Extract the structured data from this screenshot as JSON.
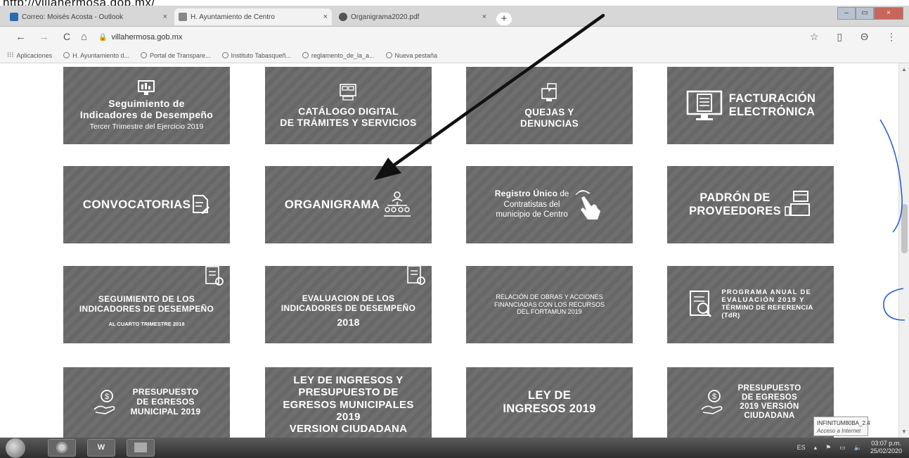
{
  "caption_url": "http://villahermosa.gob.mx/",
  "tabs": [
    {
      "label": "Correo: Moisés Acosta - Outlook",
      "close": "×",
      "active": false
    },
    {
      "label": "H. Ayuntamiento de Centro",
      "close": "×",
      "active": true
    },
    {
      "label": "Organigrama2020.pdf",
      "close": "×",
      "active": false
    }
  ],
  "new_tab": "+",
  "window_controls": {
    "minimize": "–",
    "maximize": "▭",
    "close": "×"
  },
  "nav": {
    "back": "←",
    "forward": "→",
    "reload": "C",
    "home": "⌂"
  },
  "address": {
    "lock": "🔒",
    "url": "villahermosa.gob.mx"
  },
  "toolbar_right": {
    "star": "☆",
    "ext": "▯",
    "profile": "Θ",
    "menu": "⋮"
  },
  "bookmarks": [
    {
      "label": "Aplicaciones",
      "icon": "apps-icon"
    },
    {
      "label": "H. Ayuntamiento d...",
      "icon": "site-icon"
    },
    {
      "label": "Portal de Transpare...",
      "icon": "site-icon"
    },
    {
      "label": "Instituto Tabasqueñ...",
      "icon": "site-icon"
    },
    {
      "label": "reglamento_de_la_a...",
      "icon": "globe-icon"
    },
    {
      "label": "Nueva pestaña",
      "icon": "globe-icon"
    }
  ],
  "tiles": {
    "seguimiento_desempeno": {
      "line1": "Seguimiento de",
      "line2": "Indicadores de Desempeño",
      "line3": "Tercer Trimestre del Ejercicio 2019"
    },
    "catalogo": {
      "line1": "CATÁLOGO DIGITAL",
      "line2": "DE TRÁMITES Y SERVICIOS"
    },
    "quejas": {
      "line1": "QUEJAS Y",
      "line2": "DENUNCIAS"
    },
    "facturacion": {
      "line1": "FACTURACIÓN",
      "line2": "ELECTRÓNICA"
    },
    "convocatorias": {
      "line1": "CONVOCATORIAS"
    },
    "organigrama": {
      "line1": "ORGANIGRAMA"
    },
    "registro": {
      "line1a": "Registro Único",
      "line1b": " de",
      "line2": "Contratistas del",
      "line3": "municipio de Centro"
    },
    "padron": {
      "line1": "PADRÓN DE",
      "line2": "PROVEEDORES"
    },
    "seguimiento_cuarto": {
      "line1": "SEGUIMIENTO DE LOS",
      "line2": "INDICADORES DE DESEMPEÑO",
      "line3": "AL CUARTO TRIMESTRE 2018"
    },
    "evaluacion": {
      "line1": "EVALUACION DE LOS",
      "line2": "INDICADORES DE DESEMPEÑO",
      "line3": "2018"
    },
    "fortamun": {
      "line1": "RELACIÓN DE OBRAS Y ACCIONES",
      "line2": "FINANCIADAS CON LOS RECURSOS",
      "line3": "DEL FORTAMUN 2019"
    },
    "programa_anual": {
      "line1": "PROGRAMA ANUAL DE",
      "line2": "EVALUACIÓN 2019 Y",
      "line3": "TÉRMINO DE REFERENCIA",
      "line4": "(TdR)"
    },
    "presupuesto_egresos": {
      "line1": "PRESUPUESTO",
      "line2": "DE EGRESOS",
      "line3": "MUNICIPAL 2019"
    },
    "ley_ingresos_ciudadana": {
      "line1": "LEY DE INGRESOS Y",
      "line2": "PRESUPUESTO DE",
      "line3": "EGRESOS MUNICIPALES",
      "line4": "2019",
      "line5": "VERSION CIUDADANA"
    },
    "ley_ingresos_2019": {
      "line1": "LEY DE",
      "line2": "INGRESOS 2019"
    },
    "presupuesto_ciudadana": {
      "line1": "PRESUPUESTO",
      "line2": "DE EGRESOS",
      "line3": "2019 VERSIÓN",
      "line4": "CIUDADANA"
    }
  },
  "taskbar": {
    "word_label": "W",
    "language": "ES",
    "time": "03:07 p.m.",
    "date": "25/02/2020"
  },
  "notification": {
    "title": "INFINITUM80BA_2.4",
    "status": "Acceso a Internet"
  },
  "colors": {
    "tile": "#6a6a6a",
    "tabstrip": "#d7d7d7",
    "taskbar": "#3c3c3c",
    "pen_blue": "#2a5fd0"
  }
}
